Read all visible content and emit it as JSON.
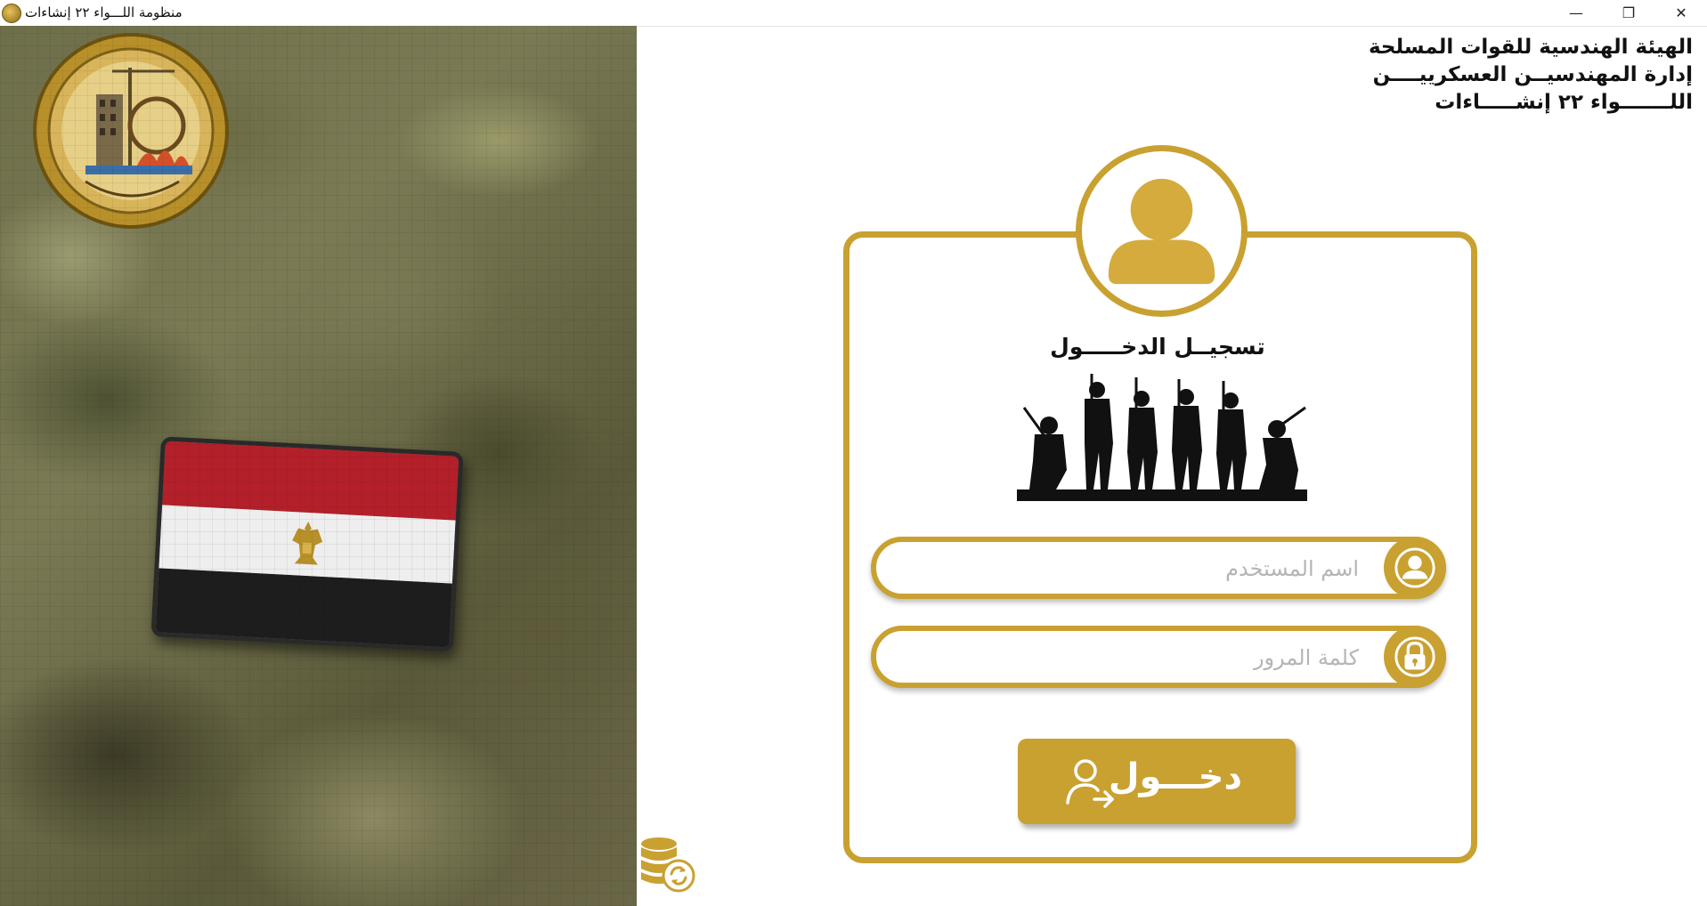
{
  "window": {
    "title": "منظومة اللـــواء ٢٢ إنشاءات",
    "controls": {
      "minimize": "—",
      "maximize": "❐",
      "close": "✕"
    }
  },
  "header": {
    "line1": "الهيئة الهندسية للقوات المسلحة",
    "line2": "إدارة المهندسيــن العسكرييــــن",
    "line3": "اللـــــــواء ٢٢ إنشـــــاءات"
  },
  "login": {
    "title": "تسجيــل الدخـــــول",
    "username_placeholder": "اسم المستخدم",
    "username_value": "",
    "password_placeholder": "كلمة المرور",
    "password_value": "",
    "submit_label": "دخـــول"
  },
  "icons": {
    "app": "emblem-icon",
    "avatar": "user-avatar-icon",
    "username": "user-icon",
    "password": "lock-icon",
    "submit": "login-user-icon",
    "database": "database-sync-icon"
  },
  "colors": {
    "accent": "#c9a131",
    "text": "#111111",
    "placeholder": "#b5b5b5"
  }
}
